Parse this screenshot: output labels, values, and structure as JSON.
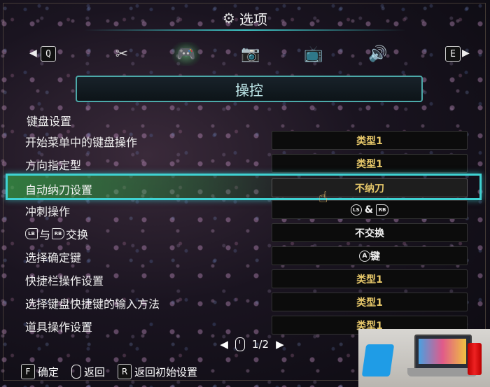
{
  "header": {
    "title": "选项"
  },
  "tabs": {
    "prev_key": "Q",
    "next_key": "E",
    "items": [
      {
        "name": "tools-tab",
        "icon": "tools-icon",
        "glyph": "✂"
      },
      {
        "name": "controls-tab",
        "icon": "gamepad-icon",
        "glyph": "🎮",
        "active": true
      },
      {
        "name": "camera-tab",
        "icon": "camera-icon",
        "glyph": "📷"
      },
      {
        "name": "display-tab",
        "icon": "tv-icon",
        "glyph": "📺"
      },
      {
        "name": "sound-tab",
        "icon": "speaker-icon",
        "glyph": "🔊"
      }
    ]
  },
  "section": {
    "title": "操控"
  },
  "group": {
    "label": "键盘设置"
  },
  "rows": [
    {
      "label": "开始菜单中的键盘操作",
      "value": "类型1"
    },
    {
      "label": "方向指定型",
      "value": "类型1"
    },
    {
      "label": "自动纳刀设置",
      "value": "不纳刀"
    },
    {
      "label": "冲刺操作",
      "value_prefix": "LS",
      "value_mid": "&",
      "value_suffix": "RB"
    },
    {
      "label_prefix": "LB",
      "label_mid": "与",
      "label_rb": "RB",
      "label": "交换",
      "value": "不交换"
    },
    {
      "label": "选择确定键",
      "value_glyph": "A",
      "value": "键"
    },
    {
      "label": "快捷栏操作设置",
      "value": "类型1"
    },
    {
      "label": "选择键盘快捷键的输入方法",
      "value": "类型1"
    },
    {
      "label": "道具操作设置",
      "value": "类型1"
    }
  ],
  "pager": {
    "current": "1",
    "separator": "/",
    "total": "2"
  },
  "footer": {
    "confirm_key": "F",
    "confirm_label": "确定",
    "back_label": "返回",
    "reset_key": "R",
    "reset_label": "返回初始设置"
  },
  "colors": {
    "accent": "#3fd2d2",
    "value_gold": "#e7c86a",
    "select_green": "#3cc850"
  }
}
